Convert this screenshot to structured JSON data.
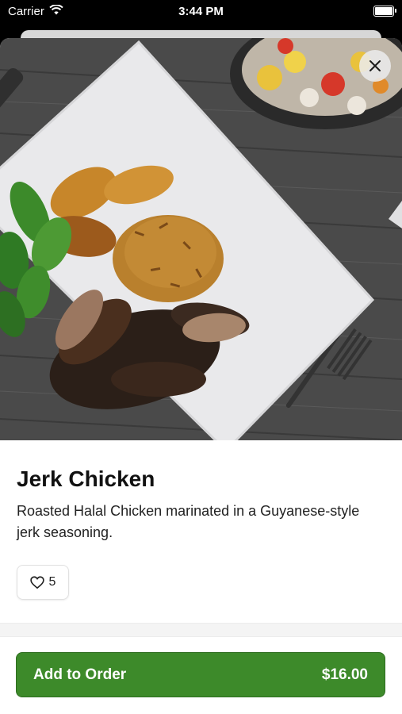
{
  "status_bar": {
    "carrier": "Carrier",
    "time": "3:44 PM",
    "icons": [
      "wifi-icon",
      "battery-icon"
    ]
  },
  "item": {
    "name": "Jerk Chicken",
    "description": "Roasted Halal Chicken marinated in a Guyanese-style jerk seasoning.",
    "likes": "5",
    "price": "$16.00"
  },
  "actions": {
    "close_icon": "close-icon",
    "like_icon": "heart-icon",
    "add_label": "Add to Order"
  },
  "colors": {
    "accent": "#3d8a2a",
    "background": "#ffffff",
    "status_bar": "#000000"
  }
}
